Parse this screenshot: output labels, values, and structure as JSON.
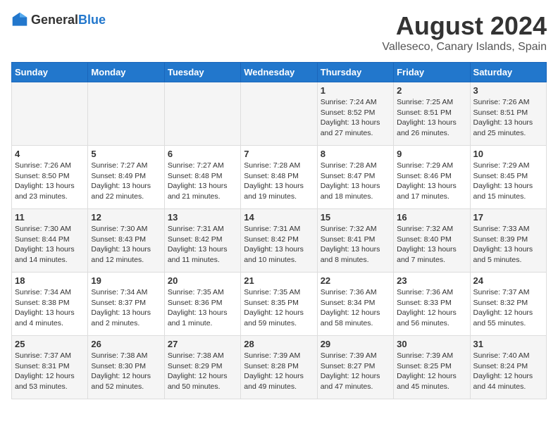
{
  "logo": {
    "general": "General",
    "blue": "Blue"
  },
  "title": "August 2024",
  "subtitle": "Valleseco, Canary Islands, Spain",
  "weekdays": [
    "Sunday",
    "Monday",
    "Tuesday",
    "Wednesday",
    "Thursday",
    "Friday",
    "Saturday"
  ],
  "rows": [
    [
      {
        "day": "",
        "sunrise": "",
        "sunset": "",
        "daylight": ""
      },
      {
        "day": "",
        "sunrise": "",
        "sunset": "",
        "daylight": ""
      },
      {
        "day": "",
        "sunrise": "",
        "sunset": "",
        "daylight": ""
      },
      {
        "day": "",
        "sunrise": "",
        "sunset": "",
        "daylight": ""
      },
      {
        "day": "1",
        "sunrise": "Sunrise: 7:24 AM",
        "sunset": "Sunset: 8:52 PM",
        "daylight": "Daylight: 13 hours and 27 minutes."
      },
      {
        "day": "2",
        "sunrise": "Sunrise: 7:25 AM",
        "sunset": "Sunset: 8:51 PM",
        "daylight": "Daylight: 13 hours and 26 minutes."
      },
      {
        "day": "3",
        "sunrise": "Sunrise: 7:26 AM",
        "sunset": "Sunset: 8:51 PM",
        "daylight": "Daylight: 13 hours and 25 minutes."
      }
    ],
    [
      {
        "day": "4",
        "sunrise": "Sunrise: 7:26 AM",
        "sunset": "Sunset: 8:50 PM",
        "daylight": "Daylight: 13 hours and 23 minutes."
      },
      {
        "day": "5",
        "sunrise": "Sunrise: 7:27 AM",
        "sunset": "Sunset: 8:49 PM",
        "daylight": "Daylight: 13 hours and 22 minutes."
      },
      {
        "day": "6",
        "sunrise": "Sunrise: 7:27 AM",
        "sunset": "Sunset: 8:48 PM",
        "daylight": "Daylight: 13 hours and 21 minutes."
      },
      {
        "day": "7",
        "sunrise": "Sunrise: 7:28 AM",
        "sunset": "Sunset: 8:48 PM",
        "daylight": "Daylight: 13 hours and 19 minutes."
      },
      {
        "day": "8",
        "sunrise": "Sunrise: 7:28 AM",
        "sunset": "Sunset: 8:47 PM",
        "daylight": "Daylight: 13 hours and 18 minutes."
      },
      {
        "day": "9",
        "sunrise": "Sunrise: 7:29 AM",
        "sunset": "Sunset: 8:46 PM",
        "daylight": "Daylight: 13 hours and 17 minutes."
      },
      {
        "day": "10",
        "sunrise": "Sunrise: 7:29 AM",
        "sunset": "Sunset: 8:45 PM",
        "daylight": "Daylight: 13 hours and 15 minutes."
      }
    ],
    [
      {
        "day": "11",
        "sunrise": "Sunrise: 7:30 AM",
        "sunset": "Sunset: 8:44 PM",
        "daylight": "Daylight: 13 hours and 14 minutes."
      },
      {
        "day": "12",
        "sunrise": "Sunrise: 7:30 AM",
        "sunset": "Sunset: 8:43 PM",
        "daylight": "Daylight: 13 hours and 12 minutes."
      },
      {
        "day": "13",
        "sunrise": "Sunrise: 7:31 AM",
        "sunset": "Sunset: 8:42 PM",
        "daylight": "Daylight: 13 hours and 11 minutes."
      },
      {
        "day": "14",
        "sunrise": "Sunrise: 7:31 AM",
        "sunset": "Sunset: 8:42 PM",
        "daylight": "Daylight: 13 hours and 10 minutes."
      },
      {
        "day": "15",
        "sunrise": "Sunrise: 7:32 AM",
        "sunset": "Sunset: 8:41 PM",
        "daylight": "Daylight: 13 hours and 8 minutes."
      },
      {
        "day": "16",
        "sunrise": "Sunrise: 7:32 AM",
        "sunset": "Sunset: 8:40 PM",
        "daylight": "Daylight: 13 hours and 7 minutes."
      },
      {
        "day": "17",
        "sunrise": "Sunrise: 7:33 AM",
        "sunset": "Sunset: 8:39 PM",
        "daylight": "Daylight: 13 hours and 5 minutes."
      }
    ],
    [
      {
        "day": "18",
        "sunrise": "Sunrise: 7:34 AM",
        "sunset": "Sunset: 8:38 PM",
        "daylight": "Daylight: 13 hours and 4 minutes."
      },
      {
        "day": "19",
        "sunrise": "Sunrise: 7:34 AM",
        "sunset": "Sunset: 8:37 PM",
        "daylight": "Daylight: 13 hours and 2 minutes."
      },
      {
        "day": "20",
        "sunrise": "Sunrise: 7:35 AM",
        "sunset": "Sunset: 8:36 PM",
        "daylight": "Daylight: 13 hours and 1 minute."
      },
      {
        "day": "21",
        "sunrise": "Sunrise: 7:35 AM",
        "sunset": "Sunset: 8:35 PM",
        "daylight": "Daylight: 12 hours and 59 minutes."
      },
      {
        "day": "22",
        "sunrise": "Sunrise: 7:36 AM",
        "sunset": "Sunset: 8:34 PM",
        "daylight": "Daylight: 12 hours and 58 minutes."
      },
      {
        "day": "23",
        "sunrise": "Sunrise: 7:36 AM",
        "sunset": "Sunset: 8:33 PM",
        "daylight": "Daylight: 12 hours and 56 minutes."
      },
      {
        "day": "24",
        "sunrise": "Sunrise: 7:37 AM",
        "sunset": "Sunset: 8:32 PM",
        "daylight": "Daylight: 12 hours and 55 minutes."
      }
    ],
    [
      {
        "day": "25",
        "sunrise": "Sunrise: 7:37 AM",
        "sunset": "Sunset: 8:31 PM",
        "daylight": "Daylight: 12 hours and 53 minutes."
      },
      {
        "day": "26",
        "sunrise": "Sunrise: 7:38 AM",
        "sunset": "Sunset: 8:30 PM",
        "daylight": "Daylight: 12 hours and 52 minutes."
      },
      {
        "day": "27",
        "sunrise": "Sunrise: 7:38 AM",
        "sunset": "Sunset: 8:29 PM",
        "daylight": "Daylight: 12 hours and 50 minutes."
      },
      {
        "day": "28",
        "sunrise": "Sunrise: 7:39 AM",
        "sunset": "Sunset: 8:28 PM",
        "daylight": "Daylight: 12 hours and 49 minutes."
      },
      {
        "day": "29",
        "sunrise": "Sunrise: 7:39 AM",
        "sunset": "Sunset: 8:27 PM",
        "daylight": "Daylight: 12 hours and 47 minutes."
      },
      {
        "day": "30",
        "sunrise": "Sunrise: 7:39 AM",
        "sunset": "Sunset: 8:25 PM",
        "daylight": "Daylight: 12 hours and 45 minutes."
      },
      {
        "day": "31",
        "sunrise": "Sunrise: 7:40 AM",
        "sunset": "Sunset: 8:24 PM",
        "daylight": "Daylight: 12 hours and 44 minutes."
      }
    ]
  ]
}
